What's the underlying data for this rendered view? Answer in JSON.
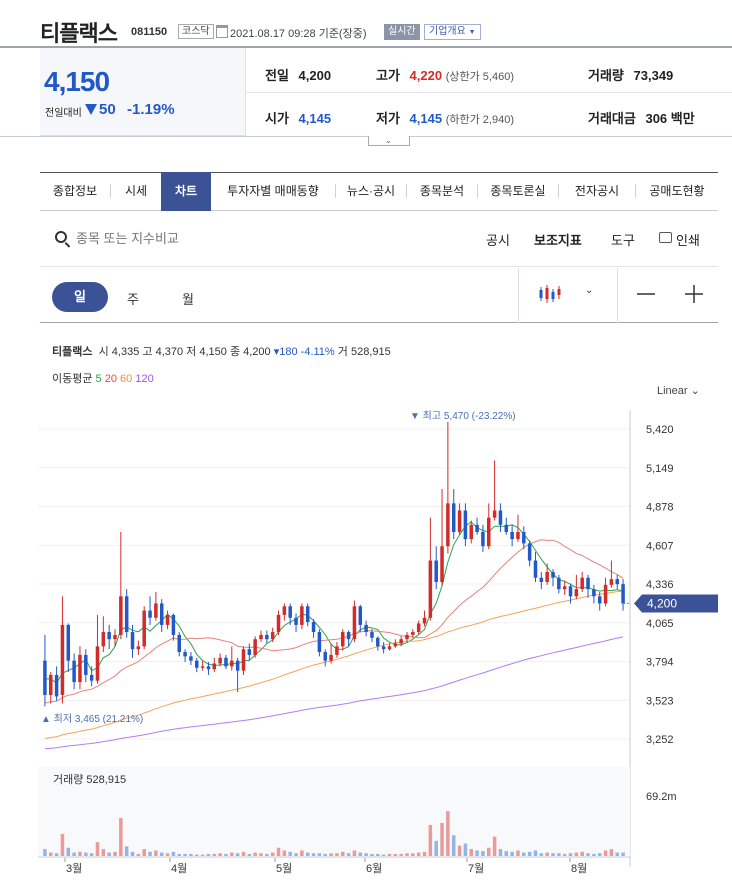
{
  "header": {
    "name": "티플랙스",
    "code": "081150",
    "market": "코스닥",
    "datetime": "2021.08.17 09:28 기준(장중)",
    "realtime": "실시간",
    "company_overview": "기업개요"
  },
  "price": {
    "current": "4,150",
    "prev_label": "전일대비",
    "change": "50",
    "change_pct": "-1.19%"
  },
  "info": {
    "prev_close_label": "전일",
    "prev_close": "4,200",
    "high_label": "고가",
    "high": "4,220",
    "upper_limit": "(상한가 5,460)",
    "volume_label": "거래량",
    "volume": "73,349",
    "open_label": "시가",
    "open": "4,145",
    "low_label": "저가",
    "low": "4,145",
    "lower_limit": "(하한가 2,940)",
    "amount_label": "거래대금",
    "amount": "306 백만"
  },
  "tabs": [
    "종합정보",
    "시세",
    "차트",
    "투자자별 매매동향",
    "뉴스·공시",
    "종목분석",
    "종목토론실",
    "전자공시",
    "공매도현황"
  ],
  "active_tab": "차트",
  "toolbar": {
    "search_placeholder": "종목 또는 지수비교",
    "disclosure": "공시",
    "indicators": "보조지표",
    "tools": "도구",
    "print": "인쇄"
  },
  "period": {
    "day": "일",
    "week": "주",
    "month": "월"
  },
  "legend": {
    "name": "티플랙스",
    "open_label": "시",
    "open": "4,335",
    "high_label": "고",
    "high": "4,370",
    "low_label": "저",
    "low": "4,150",
    "close_label": "종",
    "close": "4,200",
    "change": "▾180 -4.11%",
    "vol_label": "거",
    "vol": "528,915",
    "ma_label": "이동평균",
    "ma": [
      {
        "period": "5",
        "color": "#2fa34a"
      },
      {
        "period": "20",
        "color": "#e24848"
      },
      {
        "period": "60",
        "color": "#f0902a"
      },
      {
        "period": "120",
        "color": "#9b59e6"
      }
    ]
  },
  "scale": "Linear",
  "colors": {
    "up": "#d12b2b",
    "down": "#2159c8",
    "accent": "#3c5297"
  },
  "chart_data": {
    "type": "candlestick",
    "y_ticks": [
      "5,420",
      "5,149",
      "4,878",
      "4,607",
      "4,336",
      "4,065",
      "3,794",
      "3,523",
      "3,252"
    ],
    "y_range": [
      3252,
      5420
    ],
    "current_price_label": "4,200",
    "current_price": 4200,
    "max_label": "최고 5,470 (-23.22%)",
    "min_label": "최저 3,465 (21.21%)",
    "x_labels": [
      "3월",
      "4월",
      "5월",
      "6월",
      "7월",
      "8월"
    ],
    "volume_title": "거래량",
    "volume_value": "528,915",
    "volume_max_label": "69.2m",
    "candles": [
      [
        3800,
        3560,
        3980,
        3480
      ],
      [
        3560,
        3700,
        3720,
        3500
      ],
      [
        3700,
        3550,
        3760,
        3520
      ],
      [
        3560,
        4050,
        4250,
        3500
      ],
      [
        4050,
        3800,
        4060,
        3720
      ],
      [
        3800,
        3650,
        3850,
        3600
      ],
      [
        3650,
        3840,
        3900,
        3600
      ],
      [
        3840,
        3700,
        3880,
        3650
      ],
      [
        3700,
        3660,
        3760,
        3620
      ],
      [
        3660,
        3900,
        4120,
        3640
      ],
      [
        3900,
        4000,
        4110,
        3860
      ],
      [
        4000,
        3950,
        4050,
        3880
      ],
      [
        3950,
        3980,
        4020,
        3900
      ],
      [
        3980,
        4250,
        4700,
        3950
      ],
      [
        4250,
        4000,
        4300,
        3960
      ],
      [
        4000,
        3880,
        4050,
        3820
      ],
      [
        3880,
        3900,
        3940,
        3840
      ],
      [
        3900,
        4150,
        4180,
        3880
      ],
      [
        4150,
        4100,
        4250,
        4050
      ],
      [
        4100,
        4200,
        4280,
        4080
      ],
      [
        4200,
        4050,
        4230,
        4000
      ],
      [
        4050,
        4120,
        4150,
        4020
      ],
      [
        4120,
        3980,
        4130,
        3940
      ],
      [
        3980,
        3860,
        4000,
        3830
      ],
      [
        3860,
        3830,
        3880,
        3790
      ],
      [
        3830,
        3800,
        3860,
        3770
      ],
      [
        3800,
        3750,
        3820,
        3720
      ],
      [
        3750,
        3760,
        3800,
        3730
      ],
      [
        3760,
        3740,
        3790,
        3700
      ],
      [
        3740,
        3780,
        3820,
        3720
      ],
      [
        3780,
        3820,
        3850,
        3760
      ],
      [
        3820,
        3760,
        3840,
        3740
      ],
      [
        3760,
        3800,
        3900,
        3730
      ],
      [
        3800,
        3730,
        3820,
        3580
      ],
      [
        3730,
        3880,
        3900,
        3700
      ],
      [
        3880,
        3840,
        3920,
        3800
      ],
      [
        3840,
        3950,
        3970,
        3820
      ],
      [
        3950,
        3980,
        4010,
        3930
      ],
      [
        3980,
        3950,
        4010,
        3920
      ],
      [
        3950,
        4000,
        4030,
        3930
      ],
      [
        4000,
        4120,
        4150,
        3980
      ],
      [
        4120,
        4180,
        4200,
        4080
      ],
      [
        4180,
        4100,
        4200,
        4050
      ],
      [
        4100,
        4050,
        4130,
        4000
      ],
      [
        4050,
        4180,
        4200,
        4020
      ],
      [
        4180,
        4070,
        4200,
        4040
      ],
      [
        4070,
        4000,
        4090,
        3960
      ],
      [
        4000,
        3860,
        4020,
        3830
      ],
      [
        3860,
        3800,
        3880,
        3760
      ],
      [
        3800,
        3840,
        3920,
        3780
      ],
      [
        3840,
        3900,
        3930,
        3820
      ],
      [
        3900,
        4000,
        4020,
        3870
      ],
      [
        4000,
        3950,
        4010,
        3900
      ],
      [
        3950,
        4180,
        4220,
        3930
      ],
      [
        4180,
        4050,
        4190,
        4000
      ],
      [
        4050,
        4000,
        4080,
        3970
      ],
      [
        4000,
        3960,
        4020,
        3930
      ],
      [
        3960,
        3900,
        3970,
        3870
      ],
      [
        3900,
        3880,
        3930,
        3850
      ],
      [
        3880,
        3900,
        3920,
        3870
      ],
      [
        3900,
        3920,
        3950,
        3890
      ],
      [
        3920,
        3950,
        3970,
        3900
      ],
      [
        3950,
        3980,
        4000,
        3930
      ],
      [
        3980,
        4000,
        4020,
        3960
      ],
      [
        4000,
        4060,
        4080,
        3980
      ],
      [
        4060,
        4100,
        4150,
        4040
      ],
      [
        4100,
        4500,
        4800,
        4080
      ],
      [
        4500,
        4350,
        4600,
        4300
      ],
      [
        4350,
        4600,
        5000,
        4320
      ],
      [
        4600,
        4900,
        5470,
        4550
      ],
      [
        4900,
        4700,
        5000,
        4650
      ],
      [
        4700,
        4850,
        4900,
        4680
      ],
      [
        4850,
        4650,
        4900,
        4600
      ],
      [
        4650,
        4750,
        4780,
        4620
      ],
      [
        4750,
        4700,
        4800,
        4680
      ],
      [
        4700,
        4600,
        4750,
        4560
      ],
      [
        4600,
        4800,
        4900,
        4580
      ],
      [
        4800,
        4850,
        5200,
        4780
      ],
      [
        4850,
        4750,
        4900,
        4700
      ],
      [
        4750,
        4700,
        4800,
        4680
      ],
      [
        4700,
        4650,
        4750,
        4600
      ],
      [
        4650,
        4700,
        4820,
        4630
      ],
      [
        4700,
        4620,
        4740,
        4580
      ],
      [
        4620,
        4500,
        4640,
        4460
      ],
      [
        4500,
        4380,
        4560,
        4350
      ],
      [
        4380,
        4350,
        4420,
        4300
      ],
      [
        4350,
        4420,
        4480,
        4330
      ],
      [
        4420,
        4380,
        4440,
        4320
      ],
      [
        4380,
        4300,
        4400,
        4270
      ],
      [
        4300,
        4320,
        4360,
        4260
      ],
      [
        4320,
        4250,
        4340,
        4200
      ],
      [
        4250,
        4300,
        4400,
        4230
      ],
      [
        4300,
        4380,
        4420,
        4280
      ],
      [
        4380,
        4300,
        4400,
        4240
      ],
      [
        4300,
        4250,
        4330,
        4200
      ],
      [
        4250,
        4200,
        4280,
        4150
      ],
      [
        4200,
        4330,
        4380,
        4180
      ],
      [
        4330,
        4370,
        4500,
        4310
      ],
      [
        4370,
        4335,
        4400,
        4300
      ],
      [
        4335,
        4200,
        4370,
        4150
      ]
    ],
    "volumes": [
      0.1,
      0.05,
      0.04,
      0.32,
      0.12,
      0.05,
      0.06,
      0.05,
      0.04,
      0.2,
      0.1,
      0.05,
      0.06,
      0.55,
      0.14,
      0.06,
      0.03,
      0.1,
      0.06,
      0.08,
      0.05,
      0.04,
      0.06,
      0.03,
      0.03,
      0.03,
      0.02,
      0.02,
      0.03,
      0.03,
      0.04,
      0.03,
      0.05,
      0.04,
      0.06,
      0.03,
      0.05,
      0.04,
      0.03,
      0.05,
      0.12,
      0.08,
      0.06,
      0.04,
      0.08,
      0.05,
      0.04,
      0.04,
      0.03,
      0.04,
      0.04,
      0.06,
      0.04,
      0.08,
      0.05,
      0.04,
      0.03,
      0.03,
      0.02,
      0.03,
      0.03,
      0.03,
      0.04,
      0.04,
      0.05,
      0.06,
      0.45,
      0.22,
      0.48,
      0.65,
      0.3,
      0.15,
      0.18,
      0.1,
      0.08,
      0.07,
      0.12,
      0.28,
      0.1,
      0.07,
      0.06,
      0.08,
      0.05,
      0.06,
      0.08,
      0.04,
      0.05,
      0.04,
      0.04,
      0.03,
      0.04,
      0.05,
      0.06,
      0.04,
      0.03,
      0.04,
      0.08,
      0.1,
      0.05,
      0.05
    ]
  }
}
